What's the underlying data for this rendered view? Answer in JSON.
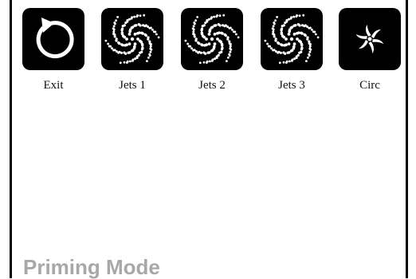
{
  "buttons": [
    {
      "label": "Exit",
      "icon": "exit-arrow-icon"
    },
    {
      "label": "Jets 1",
      "icon": "jets-swirl-icon"
    },
    {
      "label": "Jets 2",
      "icon": "jets-swirl-icon"
    },
    {
      "label": "Jets 3",
      "icon": "jets-swirl-icon"
    },
    {
      "label": "Circ",
      "icon": "circ-pump-icon"
    }
  ],
  "status": {
    "mode": "Priming Mode"
  },
  "colors": {
    "tile_background": "#000000",
    "icon_foreground": "#ffffff",
    "status_text": "#a8a8a8"
  }
}
